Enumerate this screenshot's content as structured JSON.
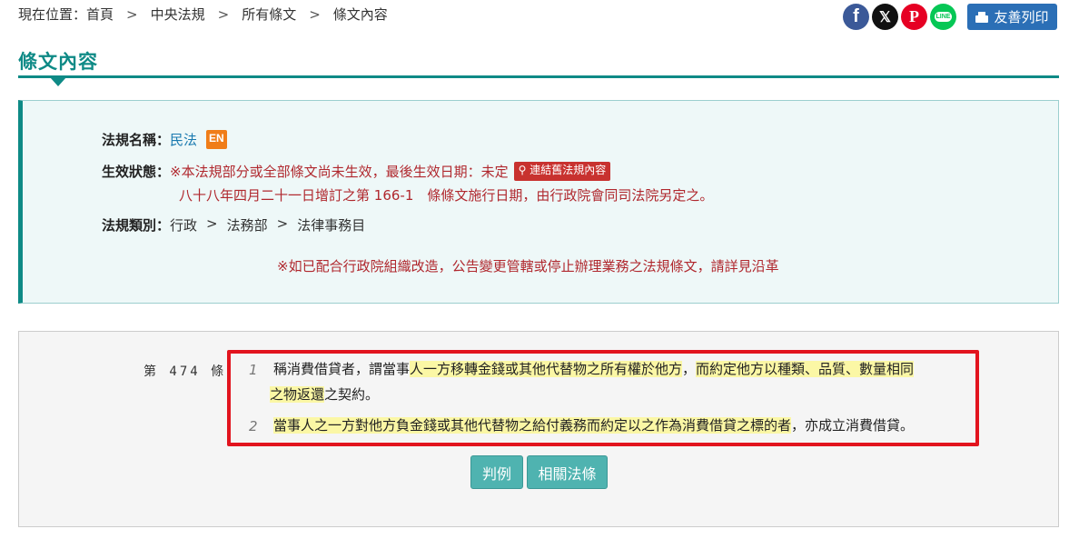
{
  "breadcrumb": {
    "prefix": "現在位置：",
    "items": [
      "首頁",
      "中央法規",
      "所有條文",
      "條文內容"
    ],
    "separator": ">"
  },
  "share": {
    "icons": [
      "facebook-icon",
      "x-icon",
      "pinterest-icon",
      "line-icon"
    ],
    "fb_glyph": "f",
    "x_glyph": "𝕏",
    "p_glyph": "P",
    "line_glyph": "LINE",
    "print_label": "友善列印"
  },
  "page_title": "條文內容",
  "info": {
    "name_label": "法規名稱：",
    "name_value": "民法",
    "en_badge": "EN",
    "status_label": "生效狀態：",
    "status_text": "※本法規部分或全部條文尚未生效，最後生效日期：未定",
    "status_link": "連結舊法規內容",
    "status_text2": "八十八年四月二十一日增訂之第 166-1　條條文施行日期，由行政院會同司法院另定之。",
    "category_label": "法規類別：",
    "category_path": [
      "行政",
      "法務部",
      "法律事務目"
    ],
    "category_separator": ">",
    "notice": "※如已配合行政院組織改造，公告變更管轄或停止辦理業務之法規條文，請詳見沿革"
  },
  "article": {
    "number": "第 474 條",
    "para1_num": "1",
    "para1_a": "稱消費借貸者，謂當事",
    "para1_b": "人一方移轉金錢或其他代替物之所有權於他方",
    "para1_c": "，",
    "para1_d": "而約定他方以種類、品質、數量相同",
    "para1_e": "之物返還",
    "para1_f": "之契約。",
    "para2_num": "2",
    "para2_a": "當事人之一方對他方負金錢或其他代替物之給付義務而約定以之作為消費借貸之標的者",
    "para2_b": "，亦成立消費借貸。",
    "highlight_color": "#fbf7a5",
    "frame_color": "#e2141e"
  },
  "buttons": {
    "judgment": "判例",
    "related": "相關法條"
  },
  "colors": {
    "accent": "#0e8a86",
    "status_red": "#b0282e",
    "button_teal": "#4fb3b0",
    "print_blue": "#2b6fb6"
  }
}
